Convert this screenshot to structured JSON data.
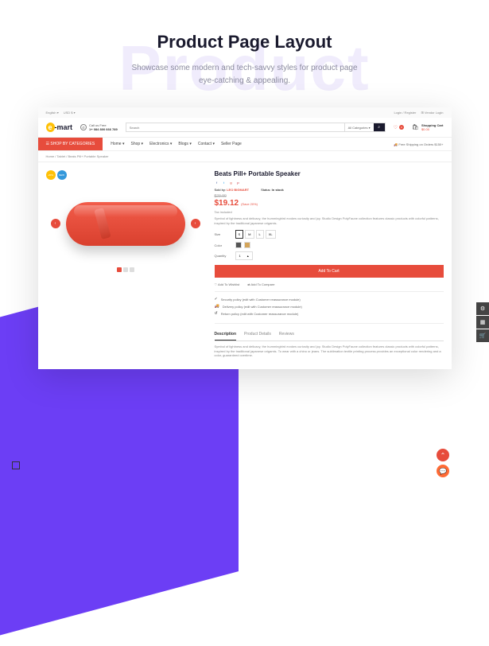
{
  "hero": {
    "bg_text": "Product",
    "title": "Product Page Layout",
    "subtitle1": "Showcase some modern and tech-savvy styles for product page",
    "subtitle2": "eye-catching & appealing."
  },
  "topbar": {
    "lang": "English ▾",
    "currency": "USD $ ▾",
    "login": "Login / Register",
    "vendor": "⊞ Vendor Login"
  },
  "header": {
    "logo_e": "e",
    "logo_dash": "-",
    "logo_mart": "mart",
    "call_label": "Call us Free",
    "call_number": "1+ 084 800 666 789",
    "search_placeholder": "Search",
    "search_cat": "All Categories ▾",
    "search_icon": "⌕",
    "wish_count": "0",
    "cart_label": "Shopping Cart",
    "cart_value": "$0.00"
  },
  "nav": {
    "categories": "☰ SHOP BY CATEGORIES",
    "items": [
      "Home ▾",
      "Shop ▾",
      "Electronics ▾",
      "Blogs ▾",
      "Contact ▾",
      "Seller Page"
    ],
    "shipping": "🚚 Free Shipping on Orders $150+"
  },
  "breadcrumb": "Home / Tablet / Beats Pill+ Portable Speaker",
  "product": {
    "badge_sale": "-20%",
    "badge_new": "NEW",
    "title": "Beats Pill+ Portable Speaker",
    "sold_label": "Sold by:",
    "sold_value": "LEO BIGMART",
    "status_label": "Status:",
    "status_value": "In stock",
    "old_price": "$23.90",
    "price": "$19.12",
    "save": "(Save 20%)",
    "tax": "Tax included",
    "desc": "Symbol of lightness and delicacy, the hummingbird evokes curiosity and joy. Studio Design PolyFaune collection features classic products with colorful patterns, inspired by the traditional japanese origamis.",
    "size_label": "Size",
    "sizes": [
      "S",
      "M",
      "L",
      "XL"
    ],
    "color_label": "Color",
    "qty_label": "Quantity",
    "qty_value": "1",
    "add_cart": "Add To Cart",
    "wishlist": "♡ Add To Wishlist",
    "compare": "⇄ Add To Compare",
    "policies": [
      {
        "icon": "✓",
        "text": "Security policy (edit with Customer reassurance module)"
      },
      {
        "icon": "🚚",
        "text": "Delivery policy (edit with Customer reassurance module)"
      },
      {
        "icon": "↺",
        "text": "Return policy (edit with Customer reassurance module)"
      }
    ],
    "tabs": [
      "Description",
      "Product Details",
      "Reviews"
    ],
    "tab_content": "Symbol of lightness and delicacy, the hummingbird evokes curiosity and joy. Studio Design PolyFaune collection features classic products with colorful patterns, inspired by the traditional japanese origamis. To wear with a chino or jeans. The sublimation textile printing process provides an exceptional color rendering and a color, guaranteed overtime."
  }
}
